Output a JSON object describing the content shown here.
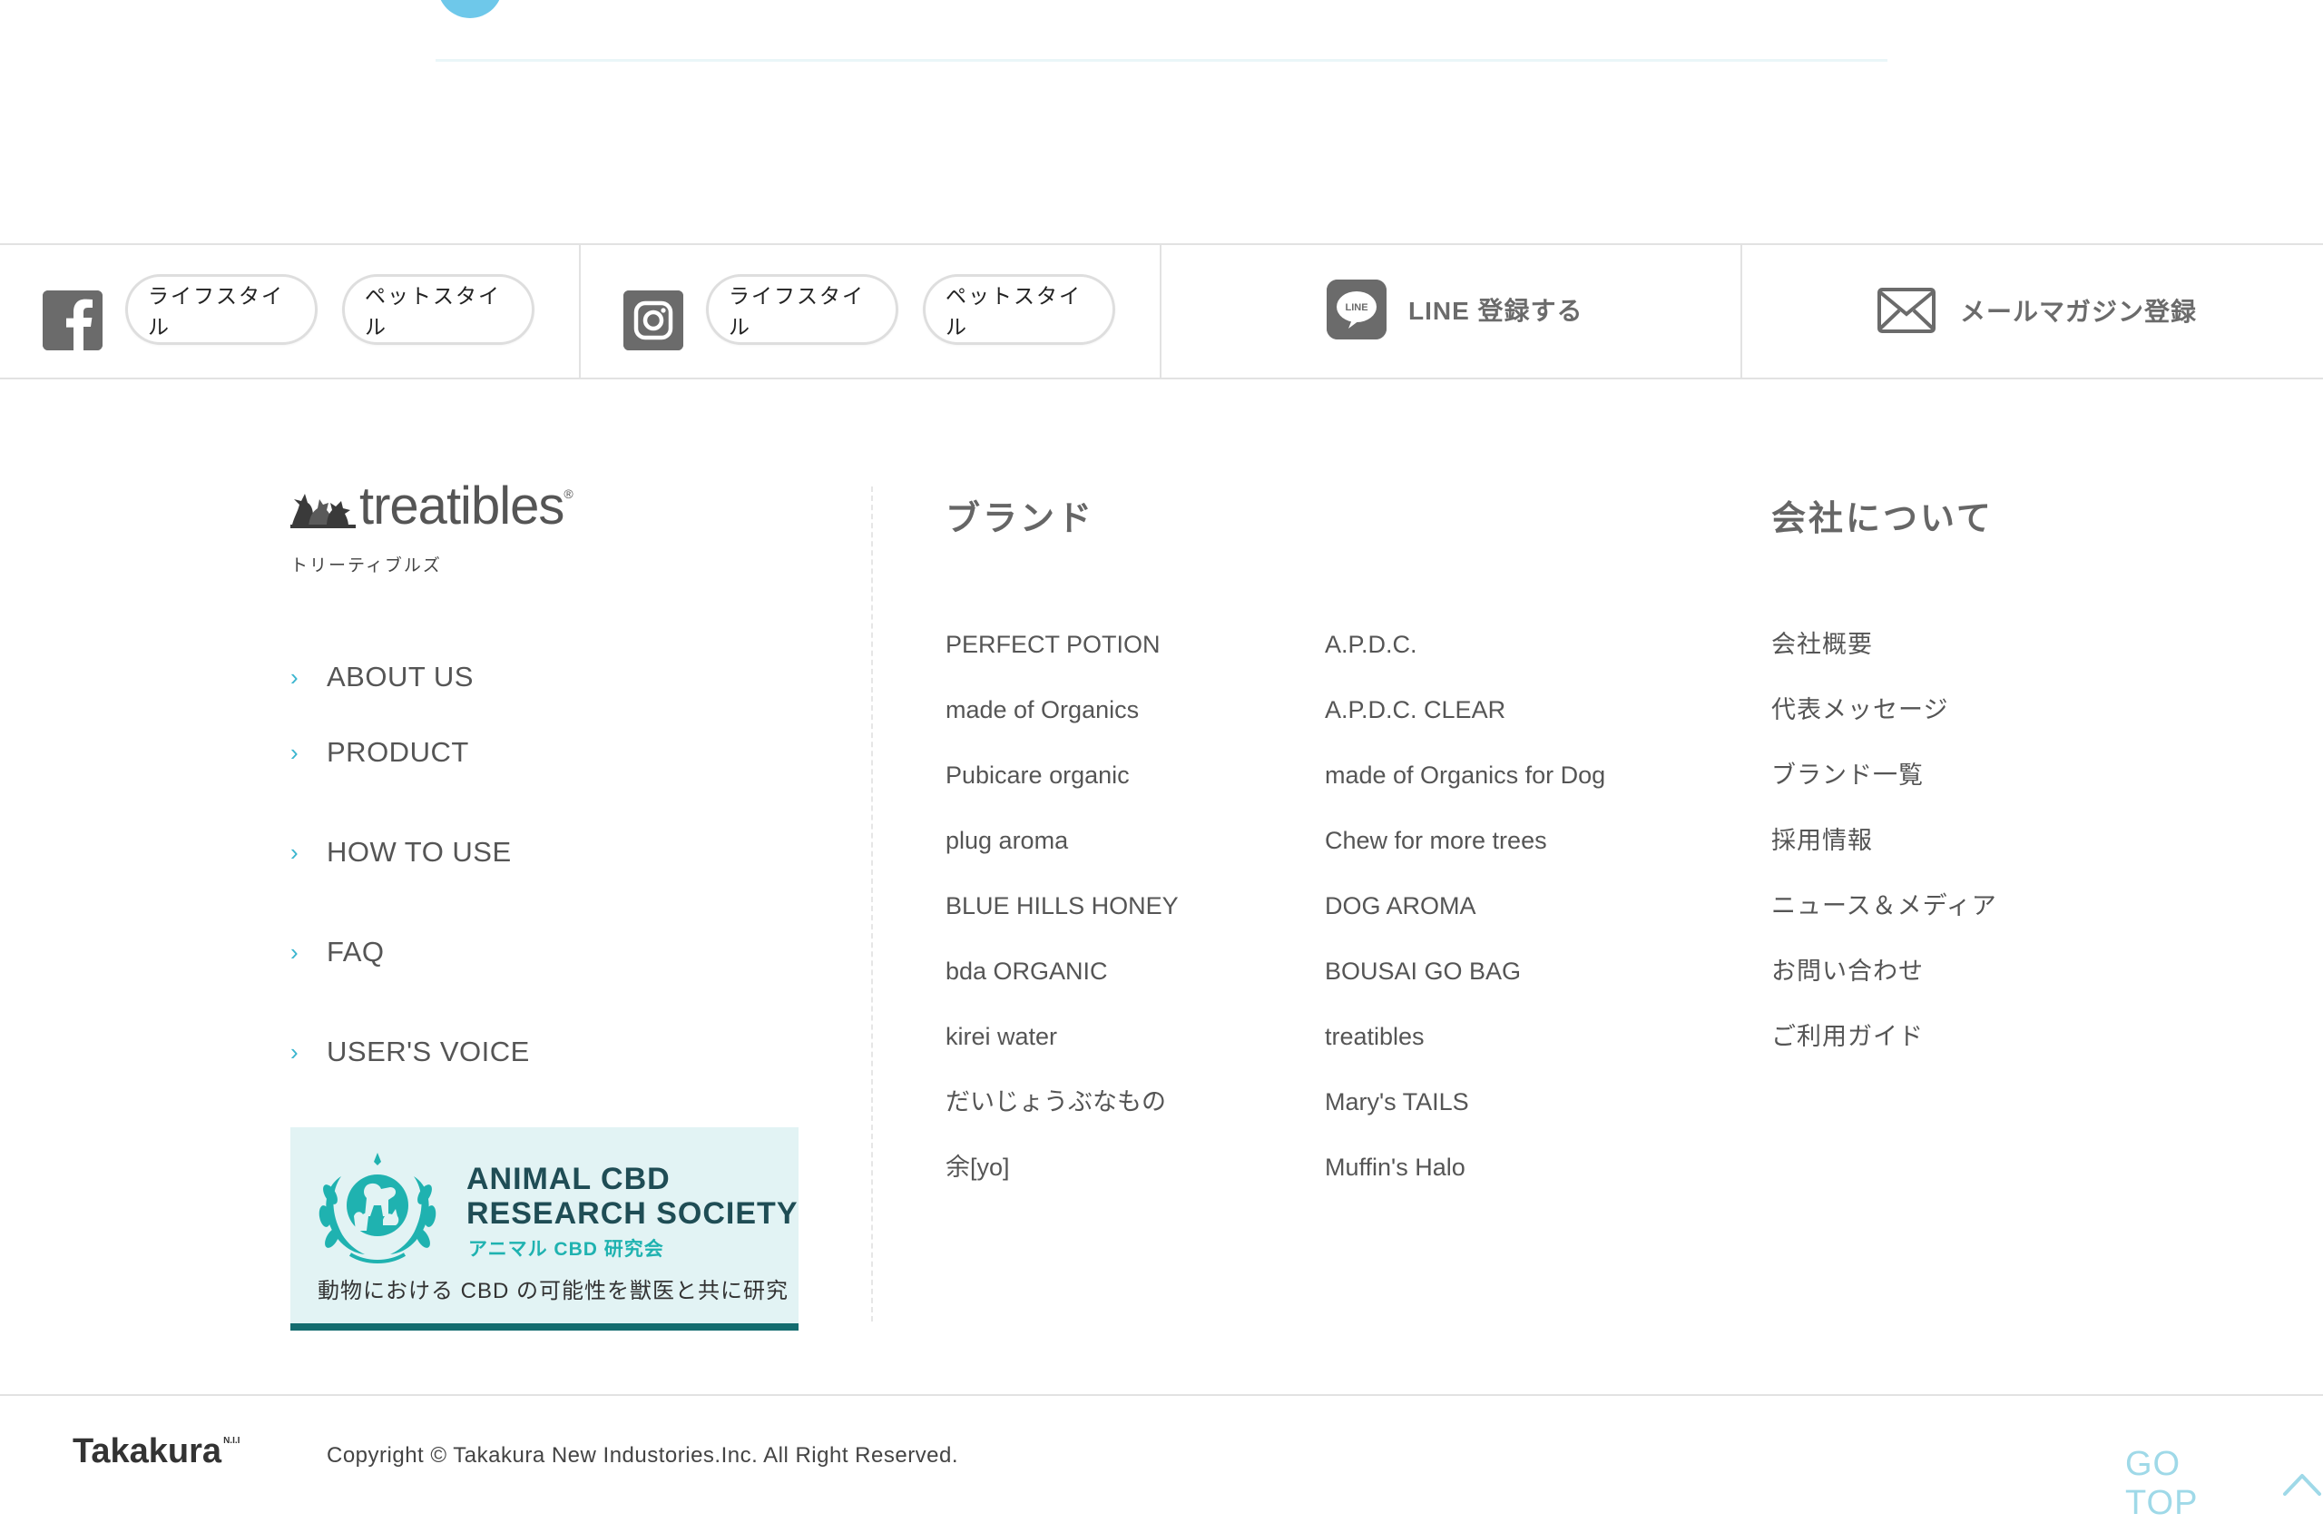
{
  "social_bar": {
    "facebook": {
      "icon": "facebook-icon",
      "buttons": [
        "ライフスタイル",
        "ペットスタイル"
      ]
    },
    "instagram": {
      "icon": "instagram-icon",
      "buttons": [
        "ライフスタイル",
        "ペットスタイル"
      ]
    },
    "line": {
      "icon": "line-icon",
      "icon_text": "LINE",
      "label": "LINE 登録する"
    },
    "mail": {
      "icon": "mail-icon",
      "label": "メールマガジン登録"
    }
  },
  "logo": {
    "name": "treatibles",
    "reg": "®",
    "subtitle": "トリーティブルズ"
  },
  "left_nav": {
    "chevron": "›",
    "items": [
      "ABOUT US",
      "PRODUCT",
      "HOW TO USE",
      "FAQ",
      "USER'S VOICE"
    ]
  },
  "cbd_banner": {
    "title_line1": "ANIMAL CBD",
    "title_line2": "RESEARCH SOCIETY",
    "title_jp": "アニマル CBD 研究会",
    "tagline": "動物における CBD の可能性を獣医と共に研究"
  },
  "brands": {
    "heading": "ブランド",
    "col1": [
      "PERFECT POTION",
      "made of Organics",
      "Pubicare organic",
      "plug aroma",
      "BLUE HILLS HONEY",
      "bda ORGANIC",
      "kirei water",
      "だいじょうぶなもの",
      "余[yo]"
    ],
    "col2": [
      "A.P.D.C.",
      "A.P.D.C. CLEAR",
      "made of Organics for Dog",
      "Chew for more trees",
      "DOG AROMA",
      "BOUSAI GO BAG",
      "treatibles",
      "Mary's TAILS",
      "Muffin's Halo"
    ]
  },
  "company": {
    "heading": "会社について",
    "links": [
      "会社概要",
      "代表メッセージ",
      "ブランド一覧",
      "採用情報",
      "ニュース＆メディア",
      "お問い合わせ",
      "ご利用ガイド"
    ]
  },
  "footer": {
    "logo": "Takakura",
    "logo_sup": "N.I.I",
    "copyright": "Copyright © Takakura New Industories.Inc. All Right Reserved.",
    "gotop": "GO TOP"
  },
  "colors": {
    "accent": "#3ab5cf",
    "gotop": "#9fd9e8",
    "banner_bg": "#e2f3f4",
    "banner_border": "#136c6f",
    "icon_gray": "#6b6b6b"
  }
}
